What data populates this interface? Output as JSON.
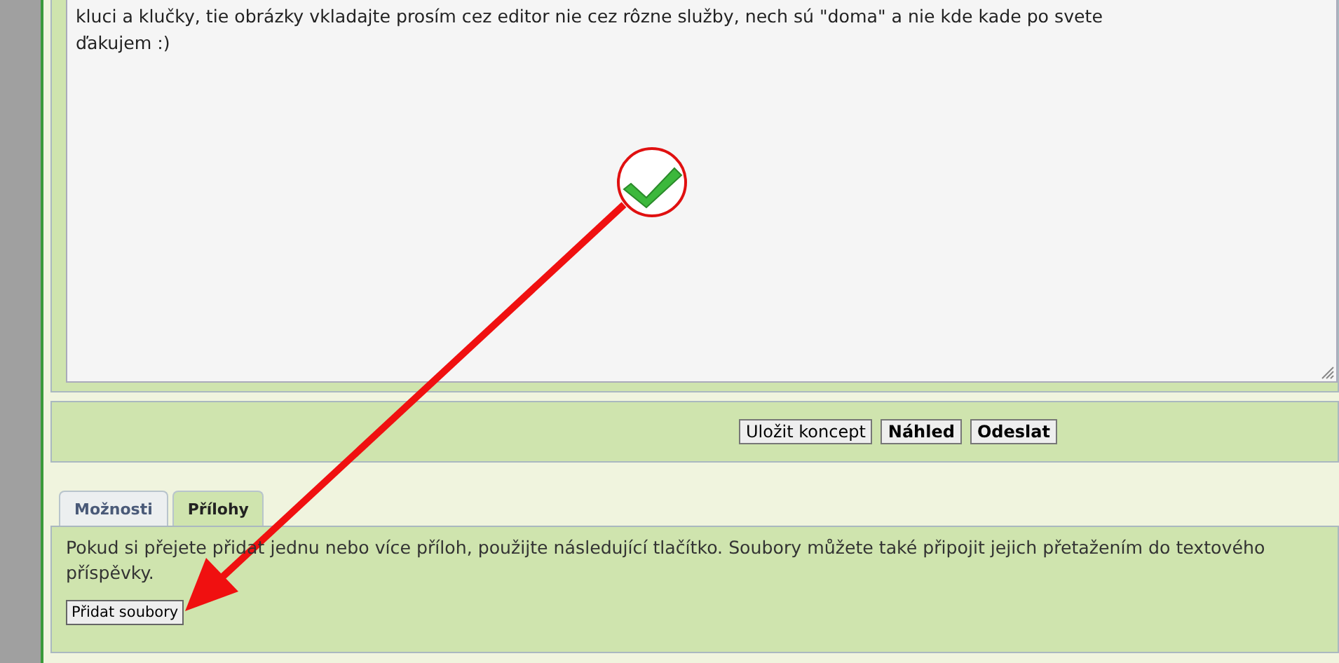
{
  "editor": {
    "lines": [
      "kluci a klučky, tie obrázky vkladajte prosím cez editor nie cez rôzne služby, nech sú \"doma\" a nie kde kade po svete",
      "ďakujem :)"
    ]
  },
  "buttons": [
    {
      "label": "Uložit koncept",
      "bold": false
    },
    {
      "label": "Náhled",
      "bold": true
    },
    {
      "label": "Odeslat",
      "bold": true
    }
  ],
  "tabs": [
    {
      "label": "Možnosti",
      "selected": false
    },
    {
      "label": "Přílohy",
      "selected": true
    }
  ],
  "attachments": {
    "text": "Pokud si přejete přidat jednu nebo více příloh, použijte následující tlačítko. Soubory můžete také připojit jejich přetažením do textového\npříspěvky.",
    "button": "Přidat soubory"
  }
}
